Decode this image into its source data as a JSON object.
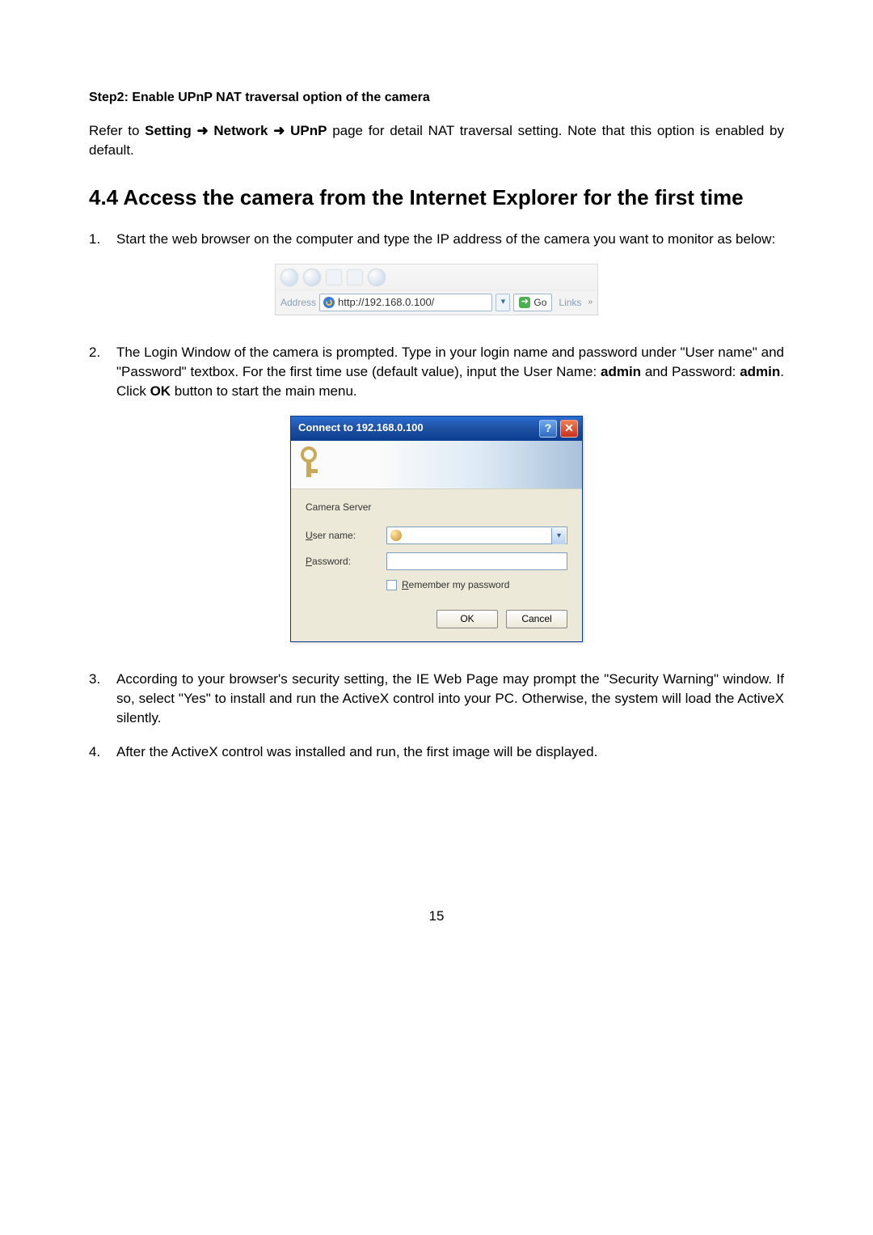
{
  "step2": {
    "title": "Step2:    Enable UPnP NAT traversal option of the camera",
    "para_prefix": "Refer to ",
    "setting": "Setting",
    "arrow": " ➜ ",
    "network": "Network",
    "upnp": "UPnP",
    "para_suffix": " page for detail NAT traversal setting. Note that this option is enabled by default."
  },
  "section_heading": "4.4  Access the camera from the Internet Explorer for the first time",
  "items": {
    "i1_num": "1.",
    "i1_text": "Start the web browser on the computer and type the IP address of the camera you want to monitor as below:",
    "i2_num": "2.",
    "i2_prefix": "The Login Window of the camera is prompted. Type in your login name and password under \"User name\" and \"Password\" textbox. For the first time use (default value), input the User Name: ",
    "i2_admin1": "admin",
    "i2_mid": " and Password: ",
    "i2_admin2": "admin",
    "i2_click": ". Click ",
    "i2_ok": "OK",
    "i2_suffix": " button to start the main menu.",
    "i3_num": "3.",
    "i3_text": "According to your browser's security setting, the IE Web Page may prompt the \"Security Warning\" window. If so, select \"Yes\" to install and run the ActiveX control into your PC. Otherwise, the system will load the ActiveX silently.",
    "i4_num": "4.",
    "i4_text": "After the ActiveX control was installed and run, the first image will be displayed."
  },
  "addressbar": {
    "label": "Address",
    "url": "http://192.168.0.100/",
    "go": "Go",
    "links": "Links"
  },
  "login": {
    "title": "Connect to 192.168.0.100",
    "realm": "Camera Server",
    "user_label_u": "U",
    "user_label_rest": "ser name:",
    "pass_label_u": "P",
    "pass_label_rest": "assword:",
    "remember_u": "R",
    "remember_rest": "emember my password",
    "ok": "OK",
    "cancel": "Cancel"
  },
  "page_number": "15"
}
